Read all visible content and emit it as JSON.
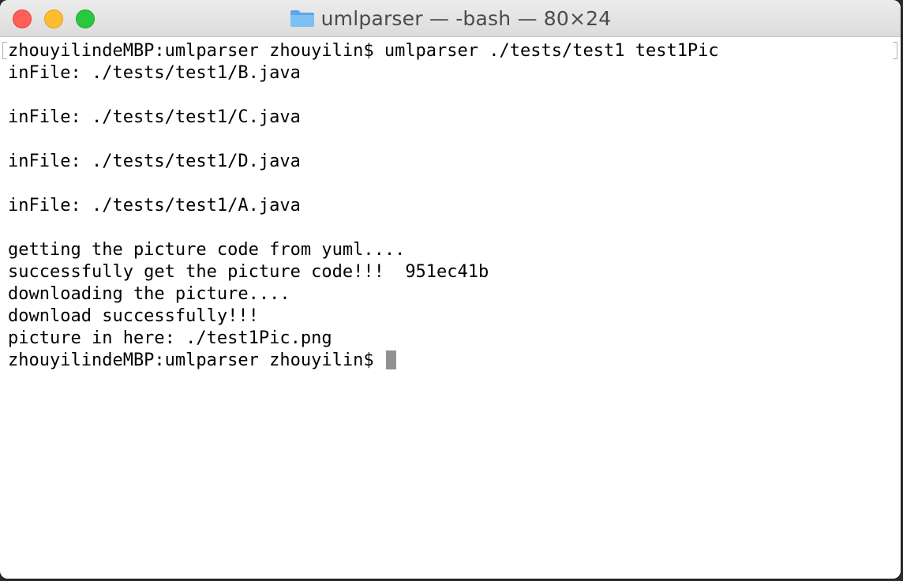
{
  "window": {
    "title": "umlparser — -bash — 80×24",
    "folder_icon": "folder-icon"
  },
  "terminal": {
    "lines": [
      "zhouyilindeMBP:umlparser zhouyilin$ umlparser ./tests/test1 test1Pic",
      "inFile: ./tests/test1/B.java",
      "",
      "inFile: ./tests/test1/C.java",
      "",
      "inFile: ./tests/test1/D.java",
      "",
      "inFile: ./tests/test1/A.java",
      "",
      "getting the picture code from yuml....",
      "successfully get the picture code!!!  951ec41b",
      "downloading the picture....",
      "download successfully!!!",
      "picture in here: ./test1Pic.png",
      "zhouyilindeMBP:umlparser zhouyilin$ "
    ]
  },
  "colors": {
    "close": "#ff5f57",
    "minimize": "#febc2e",
    "zoom": "#28c840",
    "folder": "#6fb6f0",
    "cursor": "#929292"
  }
}
